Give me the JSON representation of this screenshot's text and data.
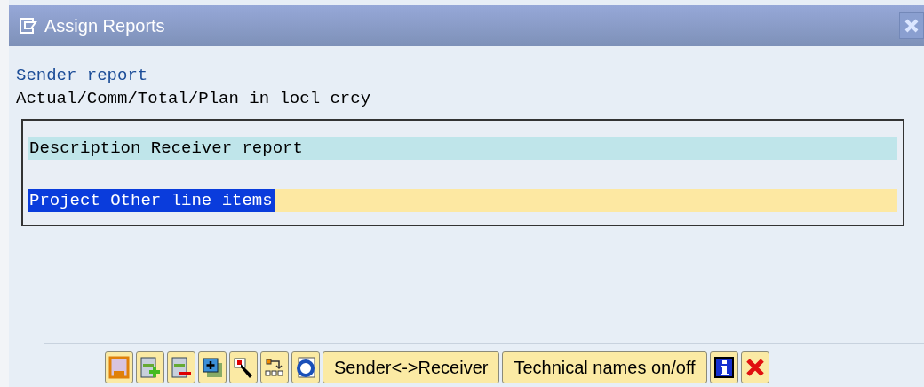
{
  "window": {
    "title": "Assign Reports"
  },
  "sender": {
    "label": "Sender report",
    "value": "Actual/Comm/Total/Plan in locl crcy"
  },
  "table": {
    "header": "Description Receiver report",
    "rows": [
      {
        "text": "Project Other line items",
        "selected": true
      }
    ]
  },
  "toolbar": {
    "buttons": [
      "Sender<->Receiver",
      "Technical names on/off"
    ]
  }
}
